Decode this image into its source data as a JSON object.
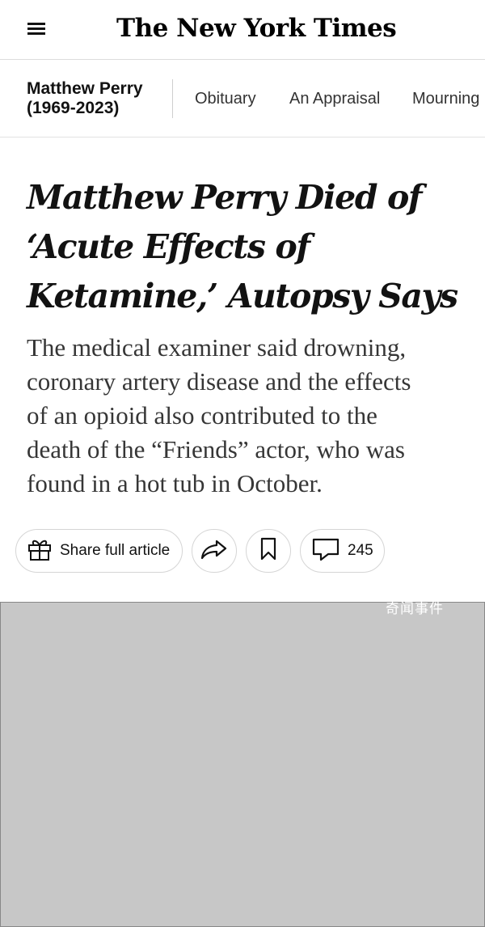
{
  "masthead": {
    "logo_text": "The New York Times",
    "menu_icon": "hamburger-menu-icon"
  },
  "section_nav": {
    "title_line1": "Matthew Perry",
    "title_line2": "(1969-2023)",
    "links": [
      "Obituary",
      "An Appraisal",
      "Mourning"
    ]
  },
  "article": {
    "headline_lines": [
      "Matthew Perry Died of",
      "‘Acute Effects of",
      "Ketamine,’ Autopsy Says"
    ],
    "summary_lines": [
      "The medical examiner said drowning,",
      "coronary artery disease and the effects",
      "of an opioid also contributed to the",
      "death of the “Friends” actor, who was",
      "found in a hot tub in October."
    ]
  },
  "actions": {
    "share_label": "Share full article",
    "share_icon": "gift-icon",
    "forward_icon": "share-arrow-icon",
    "save_icon": "bookmark-icon",
    "comments_icon": "comment-icon",
    "comments_count": "245"
  },
  "photo": {
    "watermark": "奇闻事件"
  }
}
